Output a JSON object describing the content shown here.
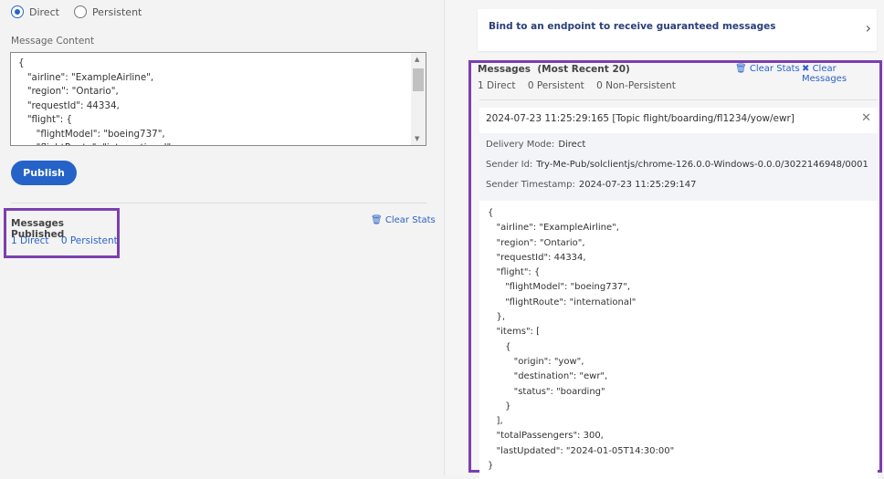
{
  "publisher": {
    "delivery_options": [
      {
        "label": "Direct",
        "selected": true
      },
      {
        "label": "Persistent",
        "selected": false
      }
    ],
    "message_content_label": "Message Content",
    "message_content": "{\n   \"airline\": \"ExampleAirline\",\n   \"region\": \"Ontario\",\n   \"requestId\": 44334,\n   \"flight\": {\n      \"flightModel\": \"boeing737\",\n      \"flightRoute\": \"international\"",
    "publish_label": "Publish",
    "stats_title": "Messages Published",
    "direct": "1 Direct",
    "persistent": "0 Persistent",
    "clear_stats": "Clear Stats"
  },
  "subscriber": {
    "bind_text": "Bind to an endpoint to receive guaranteed messages",
    "messages_title": "Messages  (Most Recent 20)",
    "clear_stats": "Clear Stats",
    "clear_messages": "Clear Messages",
    "direct": "1 Direct",
    "persistent": "0 Persistent",
    "non_persistent": "0 Non-Persistent",
    "message": {
      "header": "2024-07-23 11:25:29:165 [Topic flight/boarding/fl1234/yow/ewr]",
      "delivery_mode_label": "Delivery Mode:",
      "delivery_mode": "Direct",
      "sender_id_label": "Sender Id:",
      "sender_id": "Try-Me-Pub/solclientjs/chrome-126.0.0-Windows-0.0.0/3022146948/0001",
      "sender_ts_label": "Sender Timestamp:",
      "sender_ts": "2024-07-23 11:25:29:147",
      "body": "{\n   \"airline\": \"ExampleAirline\",\n   \"region\": \"Ontario\",\n   \"requestId\": 44334,\n   \"flight\": {\n      \"flightModel\": \"boeing737\",\n      \"flightRoute\": \"international\"\n   },\n   \"items\": [\n      {\n         \"origin\": \"yow\",\n         \"destination\": \"ewr\",\n         \"status\": \"boarding\"\n      }\n   ],\n   \"totalPassengers\": 300,\n   \"lastUpdated\": \"2024-01-05T14:30:00\"\n}"
    }
  },
  "colors": {
    "accent": "#2563c9",
    "highlight": "#7b3fb0"
  }
}
